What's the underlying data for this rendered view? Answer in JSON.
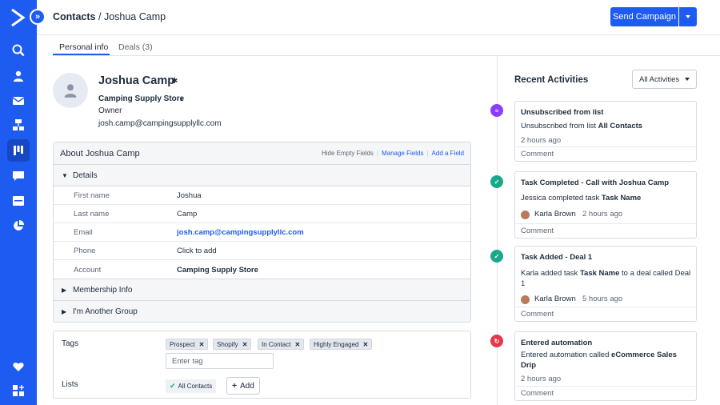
{
  "breadcrumb": {
    "root": "Contacts",
    "separator": "/",
    "current": "Joshua Camp"
  },
  "header": {
    "send_campaign": "Send Campaign"
  },
  "tabs": [
    {
      "label": "Personal info"
    },
    {
      "label": "Deals (3)"
    }
  ],
  "contact": {
    "name": "Joshua Camp",
    "company": "Camping Supply Store",
    "role": "Owner",
    "email": "josh.camp@campingsupplyllc.com"
  },
  "about": {
    "title": "About Joshua Camp",
    "links": {
      "hide_empty": "Hide Empty Fields",
      "manage": "Manage Fields",
      "add": "Add a Field"
    },
    "details_label": "Details",
    "fields": [
      {
        "label": "First name",
        "value": "Joshua"
      },
      {
        "label": "Last name",
        "value": "Camp"
      },
      {
        "label": "Email",
        "value": "josh.camp@campingsupplyllc.com"
      },
      {
        "label": "Phone",
        "value": "Click to add"
      },
      {
        "label": "Account",
        "value": "Camping Supply Store"
      }
    ],
    "groups": [
      "Membership Info",
      "I'm Another Group"
    ]
  },
  "tags_section": {
    "label": "Tags",
    "tags": [
      "Prospect",
      "Shopify",
      "In Contact",
      "Highly Engaged"
    ],
    "placeholder": "Enter tag"
  },
  "lists_section": {
    "label": "Lists",
    "chip": "All Contacts",
    "add": "Add"
  },
  "activities": {
    "title": "Recent Activities",
    "filter": "All Activities",
    "items": [
      {
        "title": "Unsubscribed from list",
        "body": "Unsubscribed from list ",
        "body_bold": "All Contacts",
        "time": "2 hours ago",
        "comment": "Comment",
        "color": "#8a3ffc"
      },
      {
        "title": "Task Completed - Call with Joshua Camp",
        "body": "Jessica completed task ",
        "body_bold": "Task Name",
        "person": "Karla Brown",
        "time": "2 hours ago",
        "comment": "Comment",
        "color": "#1aa88a"
      },
      {
        "title": "Task Added - Deal 1",
        "body": "Karla added task ",
        "body_bold": "Task Name",
        "body_tail": " to a deal called Deal 1",
        "person": "Karla Brown",
        "time": "5 hours ago",
        "comment": "Comment",
        "color": "#1aa88a"
      },
      {
        "title": "Entered automation",
        "body": "Entered automation called ",
        "body_bold": "eCommerce Sales Drip",
        "time": "2 hours ago",
        "comment": "Comment",
        "color": "#e5384f"
      }
    ]
  },
  "colors": {
    "brand": "#1e5bf0",
    "link": "#1e5bf0"
  },
  "icons": [
    "logo-icon",
    "collapse-icon",
    "search-icon",
    "contacts-icon",
    "email-icon",
    "automations-icon",
    "deals-icon",
    "conversations-icon",
    "site-icon",
    "reports-icon",
    "heart-icon",
    "apps-icon",
    "gear-icon"
  ]
}
